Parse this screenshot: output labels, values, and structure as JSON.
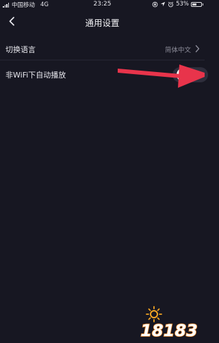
{
  "status_bar": {
    "carrier": "中国移动",
    "network": "4G",
    "time": "23:25",
    "battery_text": "53%",
    "battery_level": 0.53,
    "icons": [
      "signal-icon",
      "lock-rotation-icon",
      "location-icon",
      "alarm-icon",
      "battery-icon"
    ]
  },
  "nav": {
    "title": "通用设置",
    "back_icon": "back-chevron-icon"
  },
  "settings": {
    "language": {
      "label": "切换语言",
      "value": "简体中文"
    },
    "autoplay": {
      "label": "非WiFi下自动播放",
      "enabled": false
    }
  },
  "annotation": {
    "color": "#e8344b"
  },
  "watermark": {
    "text": "18183",
    "colors": {
      "text": "#ffffff",
      "outline": "#e8862a",
      "sun": "#f5a623"
    }
  },
  "colors": {
    "background": "#171722",
    "divider": "#262634",
    "secondary_text": "#8b8b98"
  }
}
